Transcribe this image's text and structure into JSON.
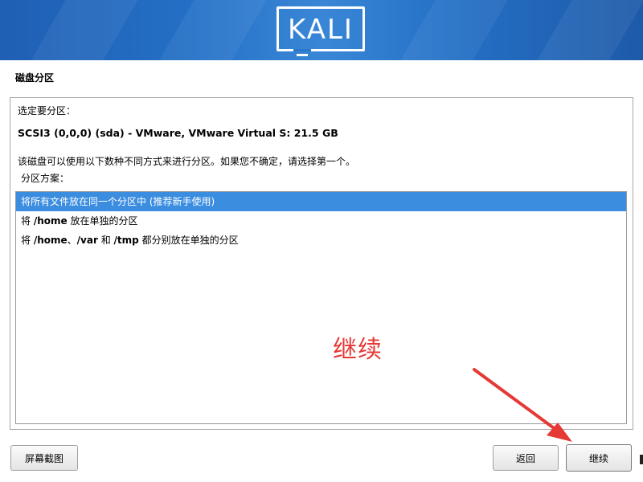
{
  "banner": {
    "logo_text": "KALI"
  },
  "page_title": "磁盘分区",
  "prompt": "选定要分区：",
  "disk": "SCSI3 (0,0,0) (sda) - VMware, VMware Virtual S: 21.5 GB",
  "description": "该磁盘可以使用以下数种不同方式来进行分区。如果您不确定，请选择第一个。",
  "scheme_label": "分区方案：",
  "options": [
    {
      "pre": "将所有文件放在同一个分区中 (推荐新手使用)",
      "selected": true
    },
    {
      "pre": "将 ",
      "bold1": "/home",
      "post": " 放在单独的分区"
    },
    {
      "pre": "将 ",
      "bold1": "/home",
      "mid1": "、",
      "bold2": "/var",
      "mid2": " 和 ",
      "bold3": "/tmp",
      "post": " 都分别放在单独的分区"
    }
  ],
  "annotation": "继续",
  "buttons": {
    "screenshot": "屏幕截图",
    "back": "返回",
    "continue": "继续"
  },
  "colors": {
    "banner": "#2470c6",
    "selection": "#3b8de0",
    "annotation": "#e53935"
  }
}
